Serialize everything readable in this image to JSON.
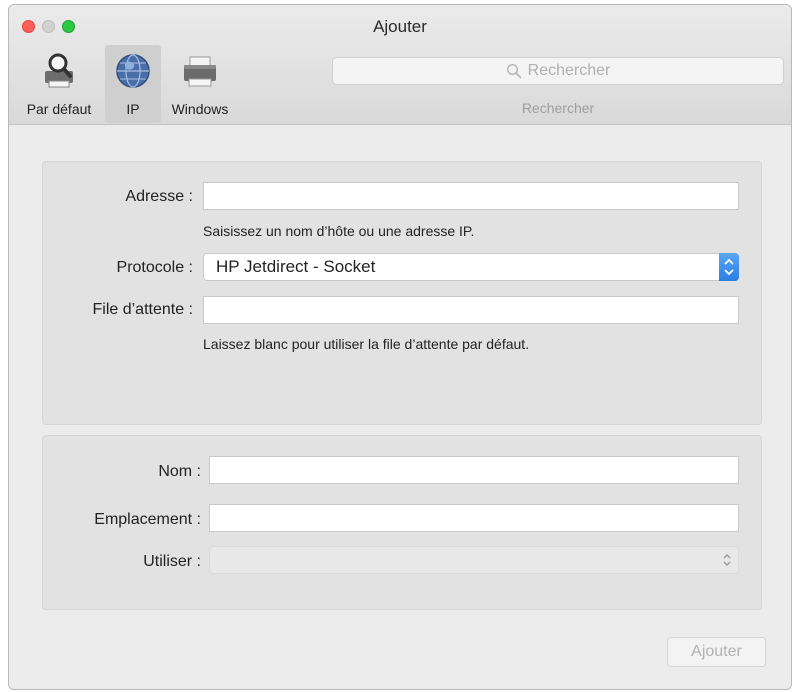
{
  "window": {
    "title": "Ajouter"
  },
  "toolbar": {
    "tabs": [
      {
        "label": "Par défaut",
        "icon": "printer-magnifier-icon"
      },
      {
        "label": "IP",
        "icon": "globe-icon",
        "selected": true
      },
      {
        "label": "Windows",
        "icon": "printer-icon"
      }
    ],
    "search": {
      "placeholder": "Rechercher",
      "caption": "Rechercher"
    }
  },
  "form": {
    "address_label": "Adresse :",
    "address_value": "",
    "address_hint": "Saisissez un nom d’hôte ou une adresse IP.",
    "protocol_label": "Protocole :",
    "protocol_value": "HP Jetdirect - Socket",
    "queue_label": "File d’attente :",
    "queue_value": "",
    "queue_hint": "Laissez blanc pour utiliser la file d’attente par défaut.",
    "name_label": "Nom :",
    "name_value": "",
    "location_label": "Emplacement :",
    "location_value": "",
    "use_label": "Utiliser :",
    "use_value": ""
  },
  "footer": {
    "add_label": "Ajouter"
  },
  "colors": {
    "accent": "#2a7ee6",
    "close": "#fc5f57",
    "zoom": "#2bc840"
  }
}
